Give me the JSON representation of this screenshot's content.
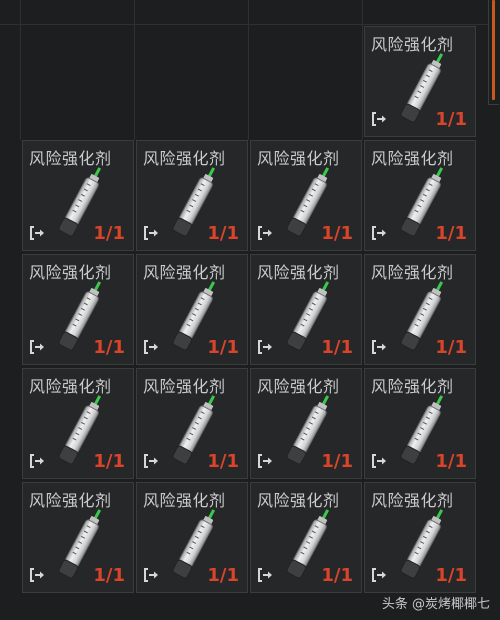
{
  "inventory": {
    "item_name": "风险强化剂",
    "quantity": "1/1",
    "item_icon": "syringe-icon",
    "action_icon": "exit-arrow-icon",
    "slot_count": 17
  },
  "colors": {
    "background": "#1d1e1f",
    "cell": "#262728",
    "label": "#c9cbcd",
    "quantity": "#d9442b",
    "accent": "#c45a20",
    "syringe_tip": "#3cc84c"
  },
  "watermark": "头条 @炭烤椰椰七"
}
